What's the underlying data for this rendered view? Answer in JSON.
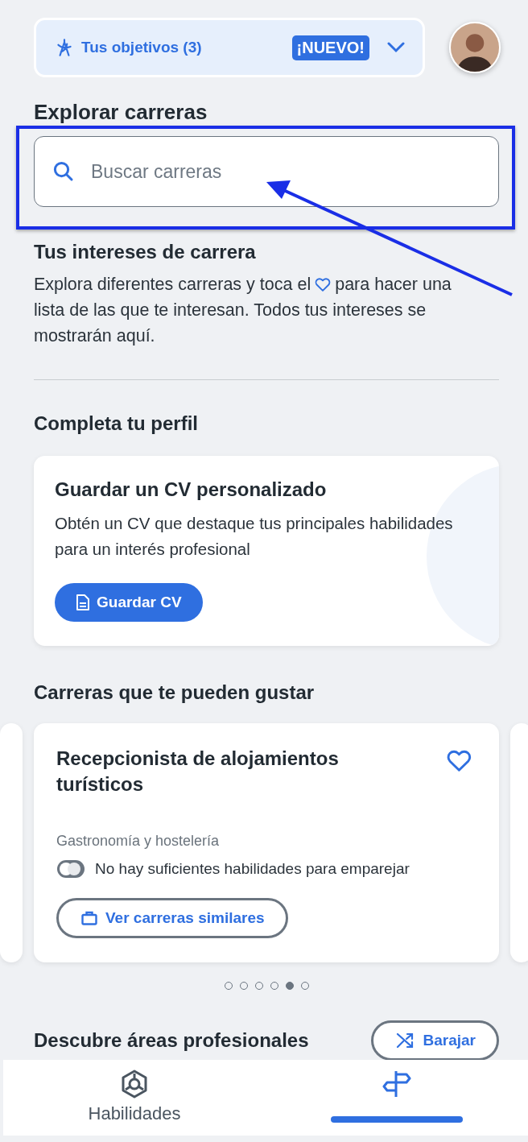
{
  "goals": {
    "label": "Tus objetivos (3)",
    "badge": "¡NUEVO!",
    "expanded": false
  },
  "explore": {
    "title": "Explorar carreras",
    "search": {
      "placeholder": "Buscar carreras"
    }
  },
  "interests": {
    "title": "Tus intereses de carrera",
    "text_before": "Explora diferentes carreras y toca el",
    "text_middle": "para hacer una",
    "text_after": "lista de las que te interesan. Todos tus intereses se mostrarán aquí."
  },
  "profile": {
    "title": "Completa tu perfil",
    "card": {
      "title": "Guardar un CV personalizado",
      "text": "Obtén un CV que destaque tus principales habilidades para un interés profesional",
      "button": "Guardar CV"
    }
  },
  "careers": {
    "title": "Carreras que te pueden gustar",
    "card": {
      "title": "Recepcionista de alojamientos turísticos",
      "favorite": false,
      "category": "Gastronomía y hostelería",
      "match": "No hay suficientes habilidades para emparejar",
      "button": "Ver carreras similares"
    },
    "dots": [
      {
        "selected": false
      },
      {
        "selected": false
      },
      {
        "selected": false
      },
      {
        "selected": false
      },
      {
        "selected": true
      },
      {
        "selected": false
      }
    ]
  },
  "areas": {
    "title": "Descubre áreas profesionales",
    "button": "Barajar"
  },
  "nav": [
    {
      "kind": "skills",
      "label": "Habilidades",
      "selected": false
    },
    {
      "kind": "careers",
      "selected": true
    }
  ]
}
